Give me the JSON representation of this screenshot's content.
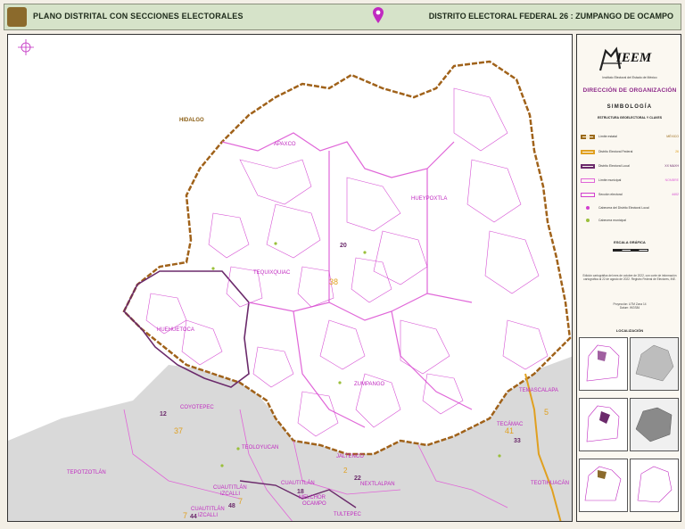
{
  "header": {
    "title_left": "PLANO DISTRITAL CON SECCIONES ELECTORALES",
    "title_right": "DISTRITO ELECTORAL FEDERAL 26 : ZUMPANGO DE OCAMPO",
    "pin_icon": "map-pin-icon"
  },
  "map": {
    "region_labels": {
      "hidalgo": "HIDALGO",
      "apaxco": "APAXCO",
      "hueypoxtla": "HUEYPOXTLA",
      "tequixquiac": "TEQUIXQUIAC",
      "huehuetoca": "HUEHUETOCA",
      "zumpango": "ZUMPANGO",
      "coyotepec": "COYOTEPEC",
      "teoloyucan": "TEOLOYUCAN",
      "tepotzotlan": "TEPOTZOTLÁN",
      "cuautitlan_izcalli": "CUAUTITLÁN\nIZCALLI",
      "cuautitlan": "CUAUTITLÁN",
      "melchor_ocampo": "MELCHOR\nOCAMPO",
      "jaltenco": "JALTENCO",
      "nextlalpan": "NEXTLALPAN",
      "tecamac": "TECÁMAC",
      "temascalapa": "TEMASCALAPA",
      "teotihuacan": "TEOTIHUACÁN",
      "cuautitlan_izcalli_2": "CUAUTITLÁN\nIZCALLI",
      "tultepec": "TULTEPEC"
    },
    "district_numbers": {
      "d20": "20",
      "d38": "38",
      "d12": "12",
      "d37": "37",
      "d2": "2",
      "d22": "22",
      "d41": "41",
      "d33": "33",
      "d5": "5",
      "d18": "18",
      "d7": "7",
      "d48": "48",
      "d7b": "7",
      "d44": "44"
    },
    "colors": {
      "state_limit": "#9b6a1a",
      "federal_district": "#e0a020",
      "local_district": "#6b2a6b",
      "municipal": "#e066d8",
      "section": "#d23fcf",
      "outside": "#d9d9d9"
    },
    "compass_icon": "compass-icon"
  },
  "sidebar": {
    "logo_icon": "ieem-logo-icon",
    "logo_text": "IEEM",
    "logo_sub": "Instituto Electoral del Estado de México",
    "heading": "DIRECCIÓN DE ORGANIZACIÓN",
    "simbologia": "SIMBOLOGÍA",
    "structure": "ESTRUCTURA GEOELECTORAL Y CLAVES",
    "legend": [
      {
        "label": "Límite estatal",
        "value": "MÉXICO"
      },
      {
        "label": "Distrito Electoral Federal",
        "value": "26"
      },
      {
        "label": "Distrito Electoral Local",
        "value": "XX MAXH"
      },
      {
        "label": "Límite municipal",
        "value": "NOMBRE"
      },
      {
        "label": "Sección electoral",
        "value": "4402"
      },
      {
        "label": "Cabecera del Distrito Electoral Local",
        "value": ""
      },
      {
        "label": "Cabecera municipal",
        "value": ""
      }
    ],
    "scale_title": "ESCALA GRÁFICA",
    "note_1": "Edición cartográfica del mes de octubre de 2022, con corte de información cartográfica al 22 de agosto de 2022. Registro Federal de Electores, INE.",
    "note_2": "Proyección: UTM Zona 14\nDatum: WGS84",
    "localization": "LOCALIZACIÓN"
  }
}
